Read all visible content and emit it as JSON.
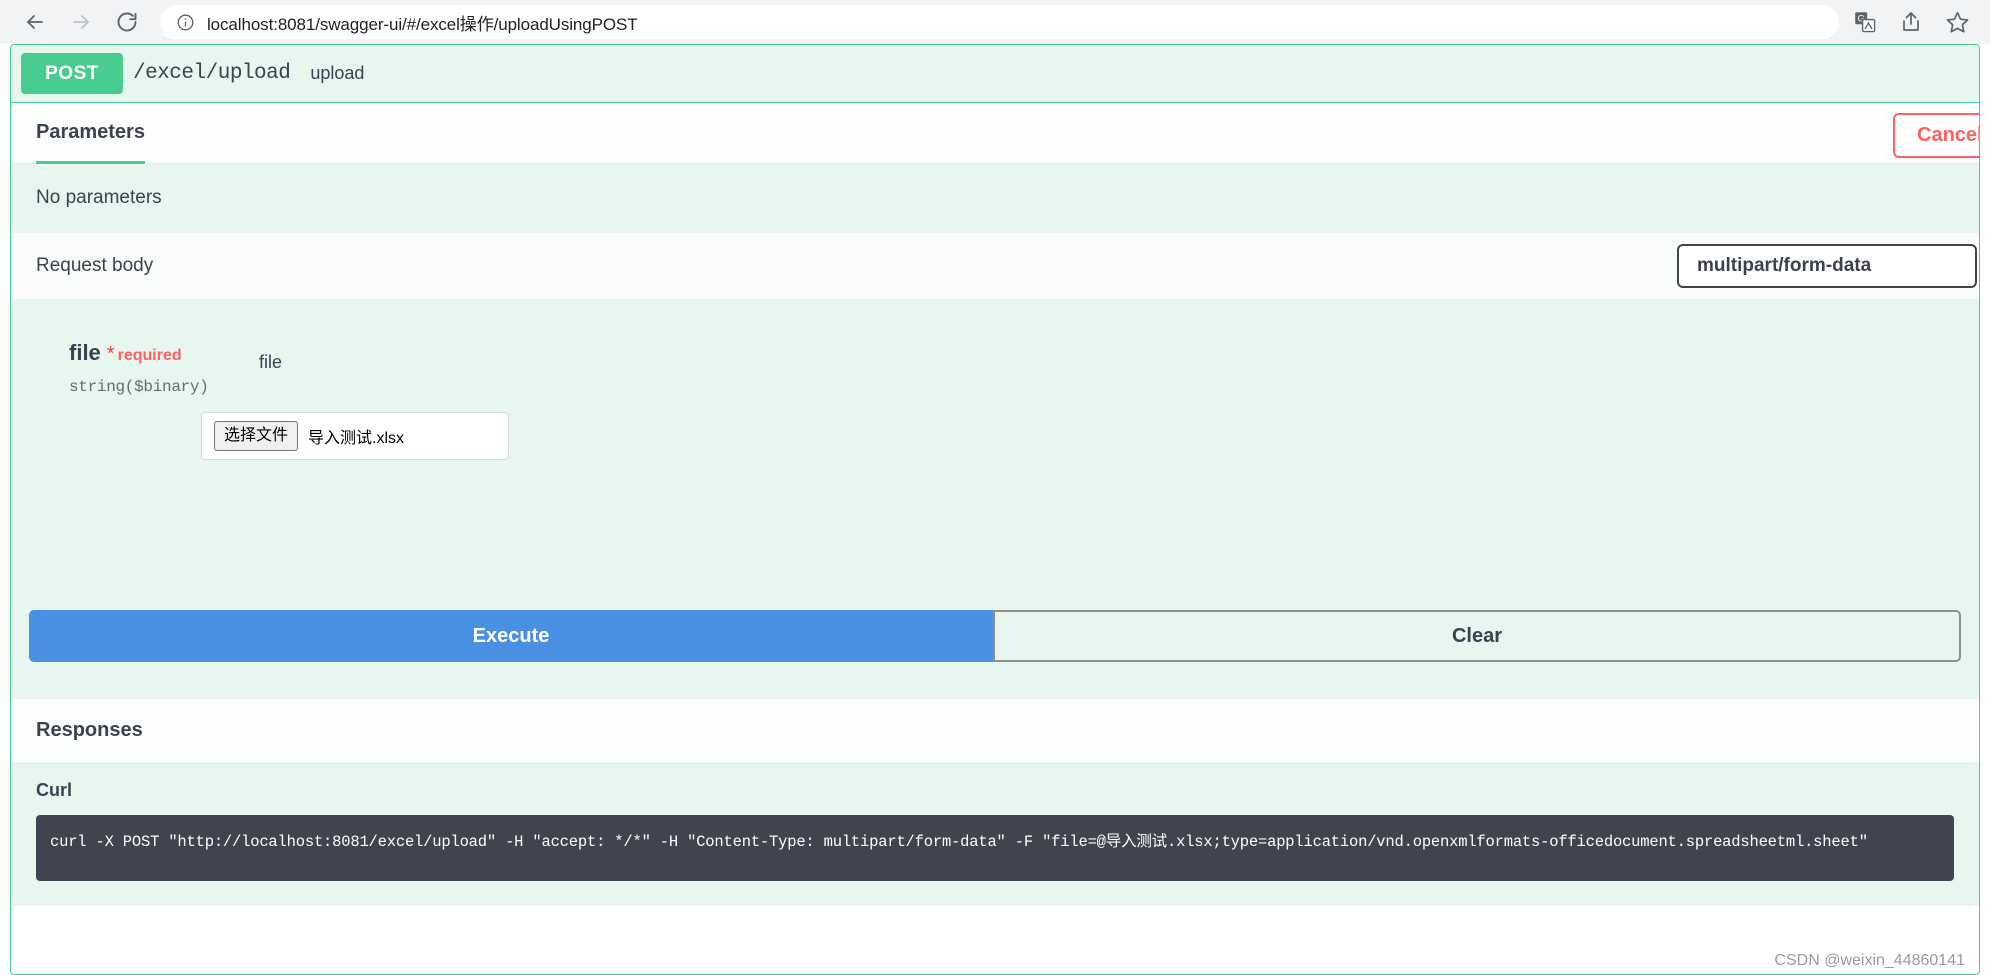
{
  "browser": {
    "back_icon": "back-arrow-icon",
    "forward_icon": "forward-arrow-icon",
    "reload_icon": "reload-icon",
    "site_info_icon": "info-circle-icon",
    "url_host": "localhost:8081",
    "url_path": "/swagger-ui/#/excel操作/uploadUsingPOST",
    "url_full": "localhost:8081/swagger-ui/#/excel操作/uploadUsingPOST",
    "toolbar_icons": [
      "translate-icon",
      "share-icon",
      "bookmark-star-icon"
    ]
  },
  "operation": {
    "method": "POST",
    "path": "/excel/upload",
    "summary": "upload",
    "accent_color": "#49cc90",
    "header_bg": "#e8f6f0"
  },
  "parameters_section": {
    "tab_label": "Parameters",
    "cancel_label": "Cancel",
    "cancel_color": "#ff6060",
    "empty_text": "No parameters"
  },
  "request_body": {
    "label": "Request body",
    "content_type": "multipart/form-data",
    "param": {
      "name": "file",
      "required_marker": "*",
      "required_label": "required",
      "type": "string($binary)",
      "description": "file",
      "file_chooser_button": "选择文件",
      "file_name": "导入测试.xlsx"
    }
  },
  "actions": {
    "execute_label": "Execute",
    "execute_color": "#4990e2",
    "clear_label": "Clear"
  },
  "responses": {
    "title": "Responses",
    "curl_title": "Curl",
    "curl_command": "curl -X POST \"http://localhost:8081/excel/upload\" -H \"accept: */*\" -H \"Content-Type: multipart/form-data\" -F \"file=@导入测试.xlsx;type=application/vnd.openxmlformats-officedocument.spreadsheetml.sheet\""
  },
  "watermark": "CSDN @weixin_44860141"
}
